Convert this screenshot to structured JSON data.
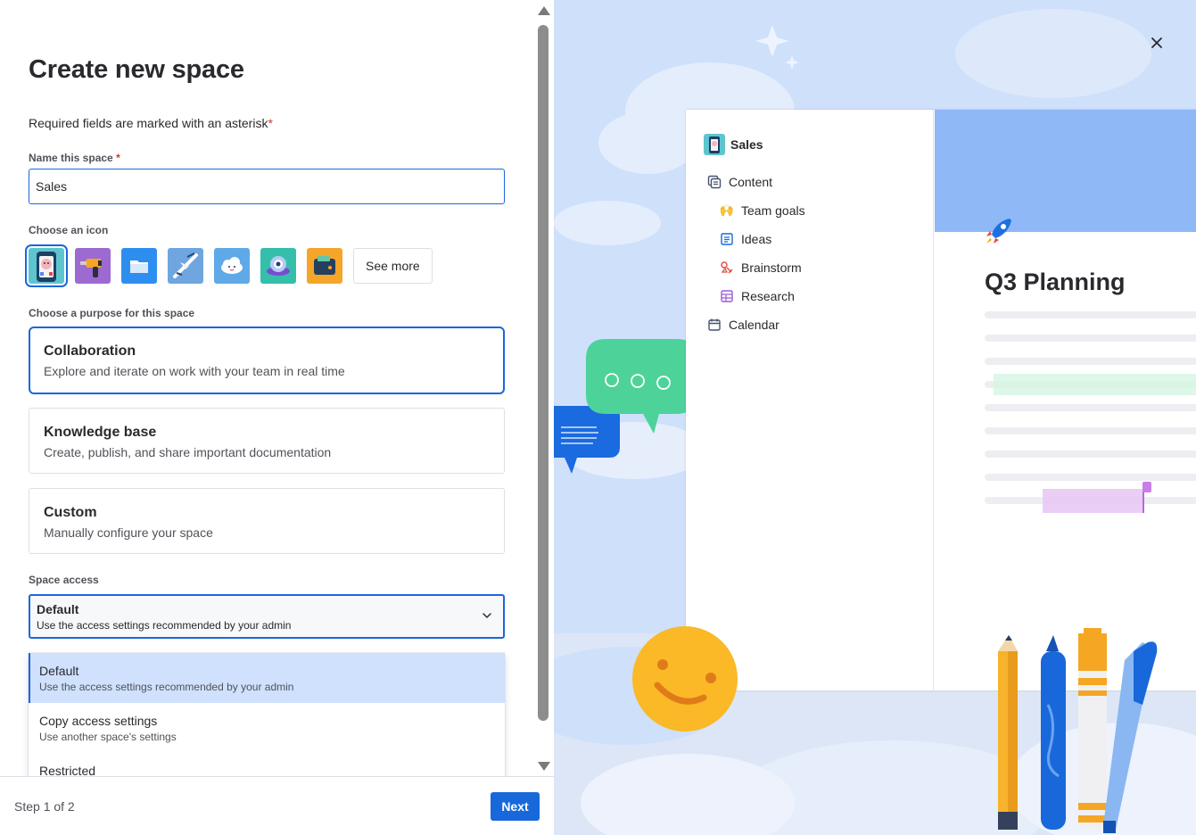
{
  "dialog": {
    "title": "Create new space",
    "required_note": "Required fields are marked with an asterisk",
    "asterisk": "*"
  },
  "name_field": {
    "label": "Name this space",
    "value": "Sales"
  },
  "icons": {
    "label": "Choose an icon",
    "options": [
      "phone-robot-icon",
      "drill-icon",
      "folder-icon",
      "airplane-icon",
      "cloud-face-icon",
      "ufo-icon",
      "wallet-icon"
    ],
    "selected_index": 0,
    "see_more_label": "See more"
  },
  "purpose": {
    "label": "Choose a purpose for this space",
    "options": [
      {
        "title": "Collaboration",
        "description": "Explore and iterate on work with your team in real time",
        "selected": true
      },
      {
        "title": "Knowledge base",
        "description": "Create, publish, and share important documentation",
        "selected": false
      },
      {
        "title": "Custom",
        "description": "Manually configure your space",
        "selected": false
      }
    ]
  },
  "access": {
    "label": "Space access",
    "selected": {
      "title": "Default",
      "description": "Use the access settings recommended by your admin"
    },
    "menu": [
      {
        "title": "Default",
        "description": "Use the access settings recommended by your admin"
      },
      {
        "title": "Copy access settings",
        "description": "Use another space's settings"
      },
      {
        "title": "Restricted",
        "description": ""
      }
    ]
  },
  "footer": {
    "step_text": "Step 1 of 2",
    "next_label": "Next"
  },
  "preview": {
    "space_name": "Sales",
    "nav": [
      {
        "label": "Content",
        "icon": "content-icon"
      },
      {
        "label": "Team goals",
        "icon": "raised-hands-icon"
      },
      {
        "label": "Ideas",
        "icon": "page-icon"
      },
      {
        "label": "Brainstorm",
        "icon": "whiteboard-icon"
      },
      {
        "label": "Research",
        "icon": "database-icon"
      },
      {
        "label": "Calendar",
        "icon": "calendar-icon"
      }
    ],
    "page_title": "Q3 Planning"
  },
  "colors": {
    "accent": "#1868db",
    "selected_menu_bg": "#cfe1fd",
    "illustration_bg": "#cfe0fb",
    "required": "#c9372c"
  }
}
